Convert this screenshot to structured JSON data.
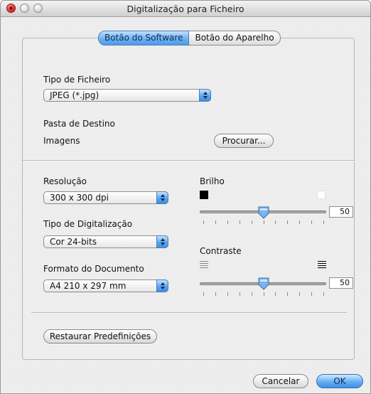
{
  "window": {
    "title": "Digitalização para Ficheiro"
  },
  "tabs": [
    {
      "label": "Botão do Software",
      "selected": true
    },
    {
      "label": "Botão do Aparelho",
      "selected": false
    }
  ],
  "file_type": {
    "label": "Tipo de Ficheiro",
    "value": "JPEG (*.jpg)"
  },
  "destination": {
    "label": "Pasta de Destino",
    "value": "Imagens",
    "browse_label": "Procurar..."
  },
  "resolution": {
    "label": "Resolução",
    "value": "300 x 300 dpi"
  },
  "scan_type": {
    "label": "Tipo de Digitalização",
    "value": "Cor 24-bits"
  },
  "document_size": {
    "label": "Formato do Documento",
    "value": "A4 210 x 297 mm"
  },
  "brightness": {
    "label": "Brilho",
    "value": "50",
    "level": 0.5
  },
  "contrast": {
    "label": "Contraste",
    "value": "50",
    "level": 0.5
  },
  "restore_defaults_label": "Restaurar Predefinições",
  "footer": {
    "cancel_label": "Cancelar",
    "ok_label": "OK"
  },
  "icons": {
    "close": "close-button-icon",
    "minimize": "minimize-button-icon",
    "zoom": "zoom-button-icon",
    "brightness_low": "black-square-icon",
    "brightness_high": "white-square-icon",
    "contrast_low": "low-contrast-lines-icon",
    "contrast_high": "high-contrast-lines-icon"
  },
  "colors": {
    "accent": "#5aa4ef",
    "close": "#dd2222"
  }
}
